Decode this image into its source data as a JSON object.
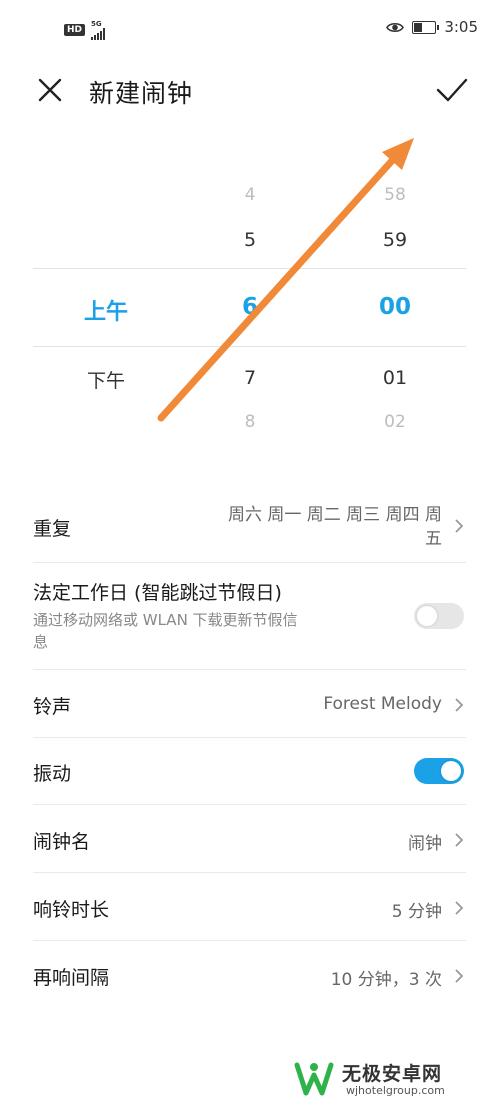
{
  "status_bar": {
    "hd": "HD",
    "network": "5G",
    "time": "3:05",
    "battery_level": 0.4
  },
  "header": {
    "title": "新建闹钟",
    "close_icon": "close-icon",
    "confirm_icon": "check-icon"
  },
  "picker": {
    "period": {
      "selected": "上午",
      "after": "下午"
    },
    "hours": {
      "far_before": "4",
      "before": "5",
      "selected": "6",
      "after": "7",
      "far_after": "8"
    },
    "minutes": {
      "far_before": "58",
      "before": "59",
      "selected": "00",
      "after": "01",
      "far_after": "02"
    },
    "accent_color": "#1aa1e6"
  },
  "settings": {
    "repeat": {
      "label": "重复",
      "value_line1": "周六 周一 周二 周三 周四 周",
      "value_line2": "五"
    },
    "workday": {
      "label": "法定工作日 (智能跳过节假日)",
      "desc_line1": "通过移动网络或 WLAN 下载更新节假信",
      "desc_line2": "息",
      "enabled": false
    },
    "ringtone": {
      "label": "铃声",
      "value": "Forest Melody"
    },
    "vibrate": {
      "label": "振动",
      "enabled": true
    },
    "name": {
      "label": "闹钟名",
      "value": "闹钟"
    },
    "duration": {
      "label": "响铃时长",
      "value": "5 分钟"
    },
    "snooze": {
      "label": "再响间隔",
      "value": "10 分钟，3 次"
    }
  },
  "annotation": {
    "color": "#f08a38"
  },
  "watermark": {
    "text": "无极安卓网",
    "url": "wjhotelgroup.com"
  }
}
